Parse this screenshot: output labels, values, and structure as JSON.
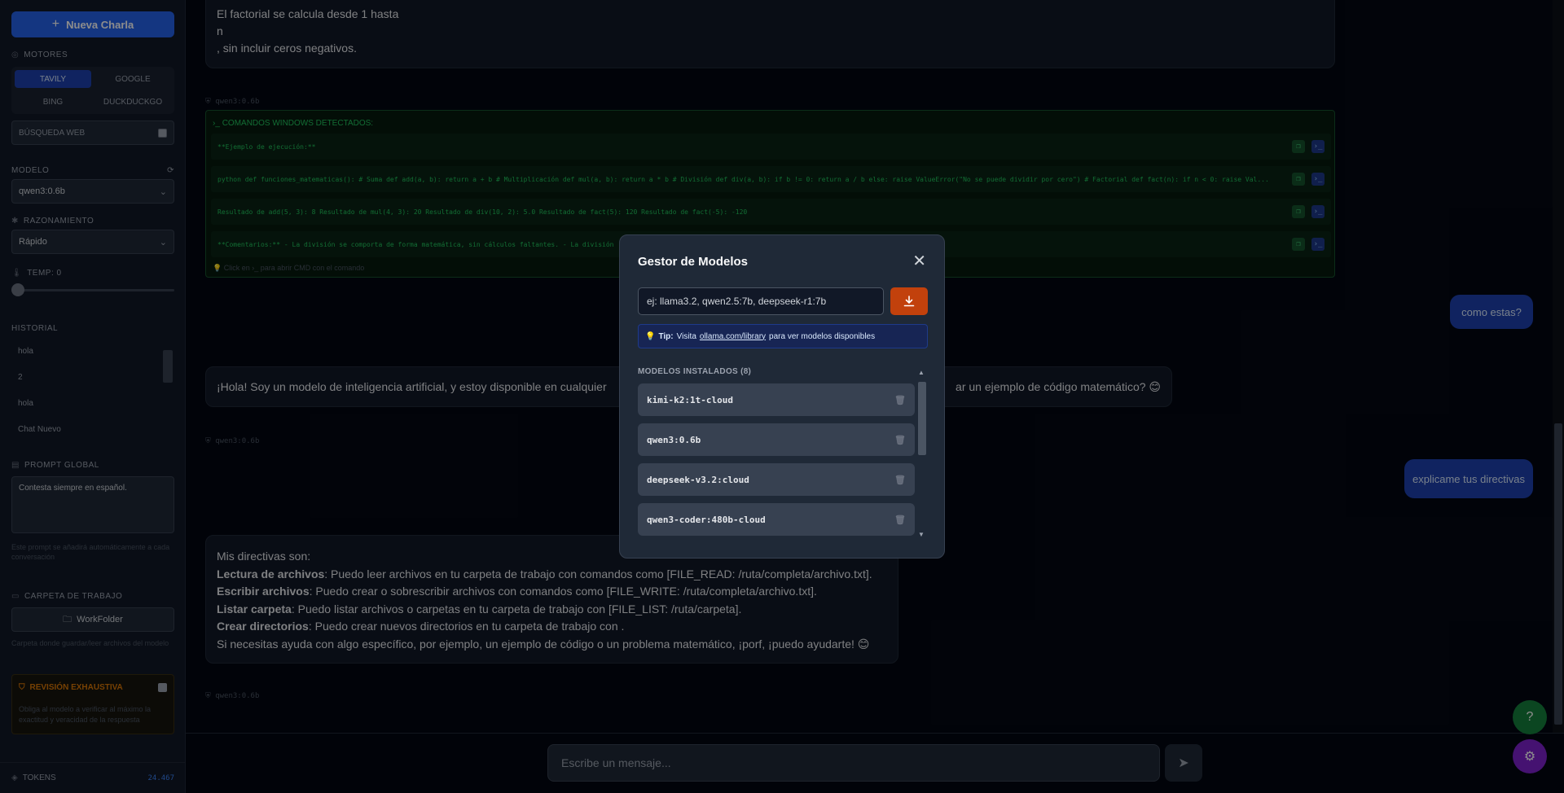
{
  "sidebar": {
    "new_chat": "Nueva Charla",
    "engines_label": "MOTORES",
    "engines": [
      "TAVILY",
      "GOOGLE",
      "BING",
      "DUCKDUCKGO"
    ],
    "web_search": "BÚSQUEDA WEB",
    "model_label": "MODELO",
    "model_value": "qwen3:0.6b",
    "reasoning_label": "RAZONAMIENTO",
    "reasoning_value": "Rápido",
    "temp_label": "TEMP: 0",
    "temperature": 0,
    "history_label": "HISTORIAL",
    "history": [
      "hola",
      "2",
      "hola",
      "Chat Nuevo"
    ],
    "prompt_label": "PROMPT GLOBAL",
    "prompt_value": "Contesta siempre en español.",
    "prompt_hint": "Este prompt se añadirá automáticamente a cada conversación",
    "workdir_label": "CARPETA DE TRABAJO",
    "workdir_button": "WorkFolder",
    "workdir_hint": "Carpeta donde guardar/leer archivos del modelo",
    "revision_label": "REVISIÓN EXHAUSTIVA",
    "revision_hint": "Obliga al modelo a verificar al máximo la exactitud y veracidad de la respuesta",
    "tokens_label": "TOKENS",
    "tokens_value": "24.467"
  },
  "chat": {
    "msg1_lines": [
      "El factorial se calcula desde 1 hasta",
      "n",
      ", sin incluir ceros negativos."
    ],
    "tag": "qwen3:0.6b",
    "cmd_title": "COMANDOS WINDOWS DETECTADOS:",
    "cmd_rows": [
      "**Ejemplo de ejecución:**",
      "python def funciones_matematicas(): # Suma def add(a, b): return a + b # Multiplicación def mul(a, b): return a * b # División def div(a, b): if b != 0: return a / b else: raise ValueError(\"No se puede dividir por cero\") # Factorial def fact(n): if n < 0: raise Val...",
      "Resultado de add(5, 3): 8 Resultado de mul(4, 3): 20 Resultado de div(10, 2): 5.0 Resultado de fact(5): 120 Resultado de fact(-5): -120",
      "**Comentarios:** - La división se comporta de forma matemática, sin cálculos faltantes. - La división ... de 1 hasta"
    ],
    "cmd_hint": "Click en ›_ para abrir CMD con el comando",
    "user1": "como estas?",
    "msg2": "¡Hola! Soy un modelo de inteligencia artificial, y estoy disponible en cualquier",
    "msg2_tail": "ar un ejemplo de código matemático? 😊",
    "user2": "explicame tus directivas",
    "msg3": [
      {
        "b": "",
        "t": "Mis directivas son:"
      },
      {
        "b": "Lectura de archivos",
        "t": ": Puedo leer archivos en tu carpeta de trabajo con comandos como [FILE_READ: /ruta/completa/archivo.txt]."
      },
      {
        "b": "Escribir archivos",
        "t": ": Puedo crear o sobrescribir archivos con comandos como [FILE_WRITE: /ruta/completa/archivo.txt]."
      },
      {
        "b": "Listar carpeta",
        "t": ": Puedo listar archivos o carpetas en tu carpeta de trabajo con [FILE_LIST: /ruta/carpeta]."
      },
      {
        "b": "Crear directorios",
        "t": ": Puedo crear nuevos directorios en tu carpeta de trabajo con ."
      },
      {
        "b": "",
        "t": "Si necesitas ayuda con algo específico, por ejemplo, un ejemplo de código o un problema matemático, ¡porf, ¡puedo ayudarte! 😊"
      }
    ],
    "input_placeholder": "Escribe un mensaje..."
  },
  "modal": {
    "title": "Gestor de Modelos",
    "input_placeholder": "ej: llama3.2, qwen2.5:7b, deepseek-r1:7b",
    "tip_label": "Tip:",
    "tip_text": "Visita",
    "tip_link": "ollama.com/library",
    "tip_tail": "para ver modelos disponibles",
    "installed_label": "MODELOS INSTALADOS (8)",
    "models": [
      "kimi-k2:1t-cloud",
      "qwen3:0.6b",
      "deepseek-v3.2:cloud",
      "qwen3-coder:480b-cloud"
    ]
  },
  "colors": {
    "accent": "#2563eb",
    "download": "#c2410c",
    "cmd_green": "#22c55e",
    "help_fab": "#15803d",
    "settings_fab": "#7e22ce"
  }
}
